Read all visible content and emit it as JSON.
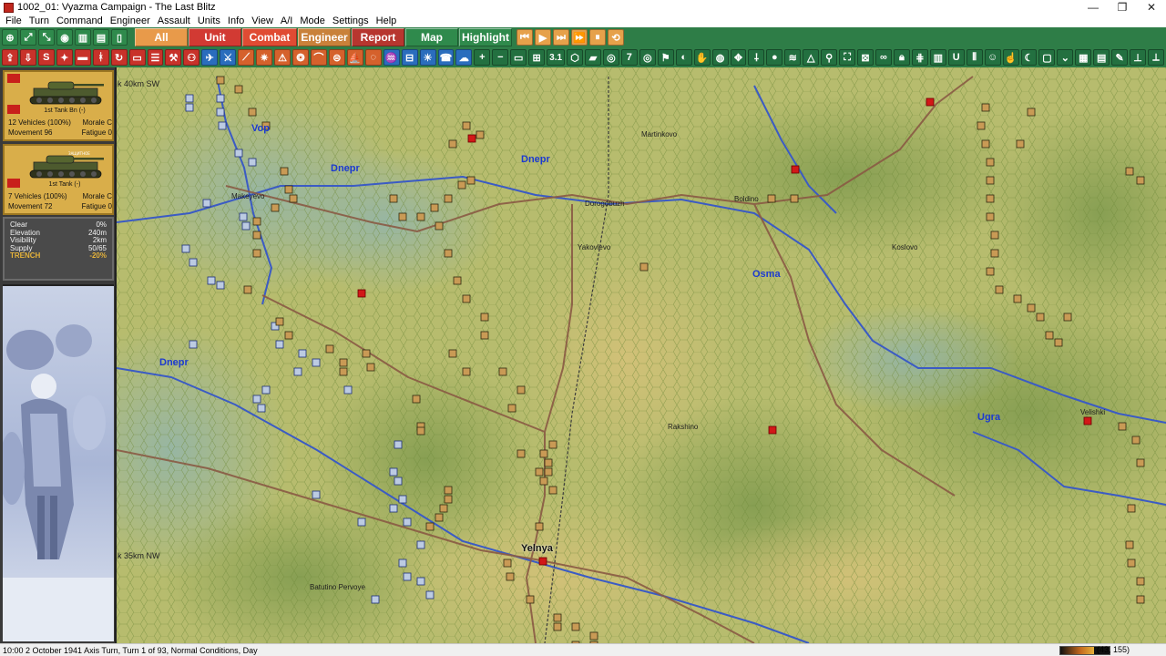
{
  "window": {
    "title": "1002_01: Vyazma Campaign - The Last Blitz",
    "controls": [
      "—",
      "❐",
      "✕"
    ]
  },
  "menu": [
    "File",
    "Turn",
    "Command",
    "Engineer",
    "Assault",
    "Units",
    "Info",
    "View",
    "A/I",
    "Mode",
    "Settings",
    "Help"
  ],
  "filter_tabs": {
    "all": "All",
    "unit": "Unit",
    "combat": "Combat",
    "engineer": "Engineer",
    "report": "Report",
    "map": "Map",
    "highlight": "Highlight"
  },
  "toolbar2": {
    "zoom_value": "3.1",
    "seven_label": "7"
  },
  "units": [
    {
      "name": "1st Tank Bn (-)",
      "vehicles": "12 Vehicles (100%)",
      "morale": "Morale C",
      "movement": "Movement 96",
      "fatigue": "Fatigue 0"
    },
    {
      "name": "1st Tank (-)",
      "banner": "ЗАЩИТНОЕ",
      "vehicles": "7 Vehicles (100%)",
      "morale": "Morale C",
      "movement": "Movement 72",
      "fatigue": "Fatigue 0"
    }
  ],
  "hex_info": [
    {
      "label": "Clear",
      "value": "0%"
    },
    {
      "label": "Elevation",
      "value": "240m"
    },
    {
      "label": "Visibility",
      "value": "2km"
    },
    {
      "label": "Supply",
      "value": "50/65"
    },
    {
      "label": "TRENCH",
      "value": "-20%"
    }
  ],
  "map": {
    "edge_labels": {
      "top": "k 40km SW",
      "bottom": "k 35km NW"
    },
    "rivers": [
      "Vop",
      "Dnepr",
      "Dnepr",
      "Dnepr",
      "Osma",
      "Ugra"
    ],
    "towns": [
      "Makeyevo",
      "Martinkovo",
      "Dorogobuzh",
      "Boldino",
      "Yakovlevo",
      "Koslovo",
      "Rakshino",
      "Velishki",
      "Batutino Pervoye"
    ],
    "major_town": "Yelnya"
  },
  "status": {
    "text": "10:00 2 October 1941 Axis Turn, Turn 1 of 93, Normal Conditions, Day",
    "coords": "(43, 155)",
    "gauge_level": 0.68
  },
  "colors": {
    "toolbar": "#2e7d47",
    "map_base": "#b9bb72",
    "river": "#3b5bc4",
    "road": "#8a5a44",
    "objective": "#d21818"
  }
}
